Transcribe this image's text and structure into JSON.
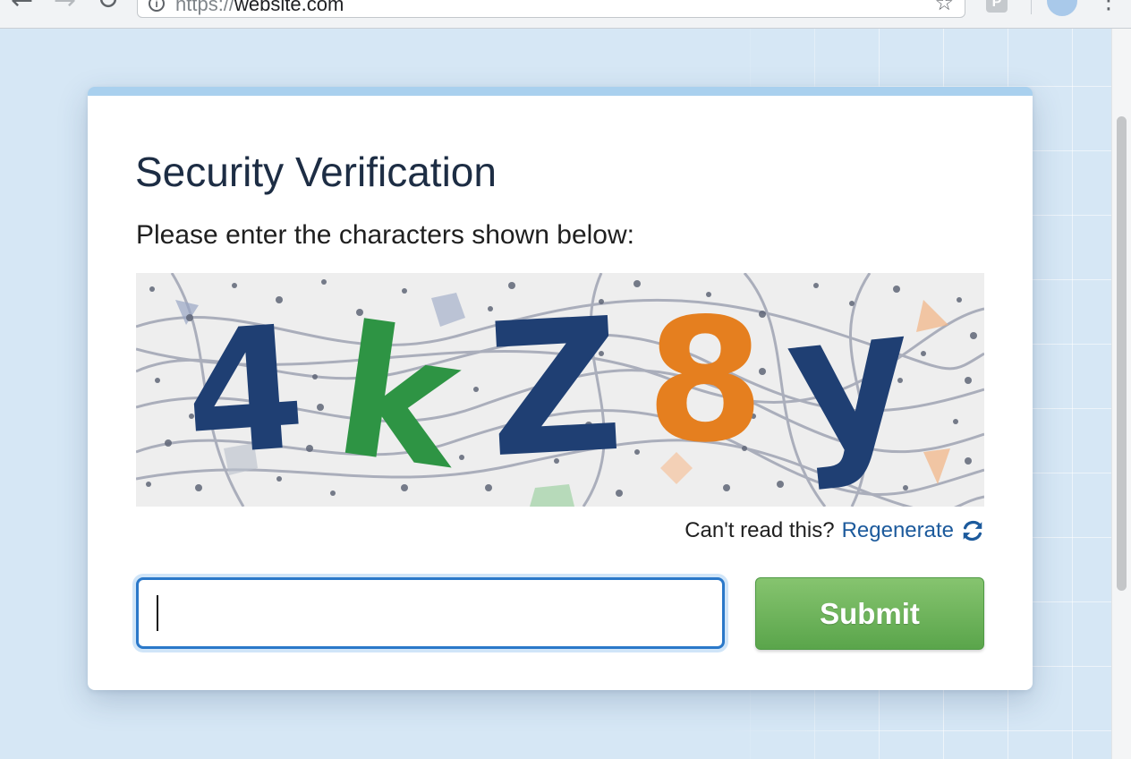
{
  "browser": {
    "url_scheme": "https://",
    "url_host": "website.com",
    "ext_badge": "P"
  },
  "card": {
    "title": "Security Verification",
    "instruction": "Please enter the characters shown below:",
    "captcha": {
      "characters": [
        {
          "char": "4",
          "color": "#1f3f73"
        },
        {
          "char": "k",
          "color": "#2e9444"
        },
        {
          "char": "Z",
          "color": "#1f3f73"
        },
        {
          "char": "8",
          "color": "#e57f1f"
        },
        {
          "char": "y",
          "color": "#1f3f73"
        }
      ]
    },
    "unreadable_prompt": "Can't read this?",
    "regenerate_label": "Regenerate",
    "input_value": "",
    "submit_label": "Submit"
  },
  "colors": {
    "accent_blue": "#2a78c9",
    "submit_green": "#5aa54b",
    "link_blue": "#1c5a9c",
    "card_top_border": "#a9d0ee"
  },
  "icons": {
    "refresh": "refresh-icon",
    "info": "info-icon",
    "bookmark": "star-icon"
  }
}
